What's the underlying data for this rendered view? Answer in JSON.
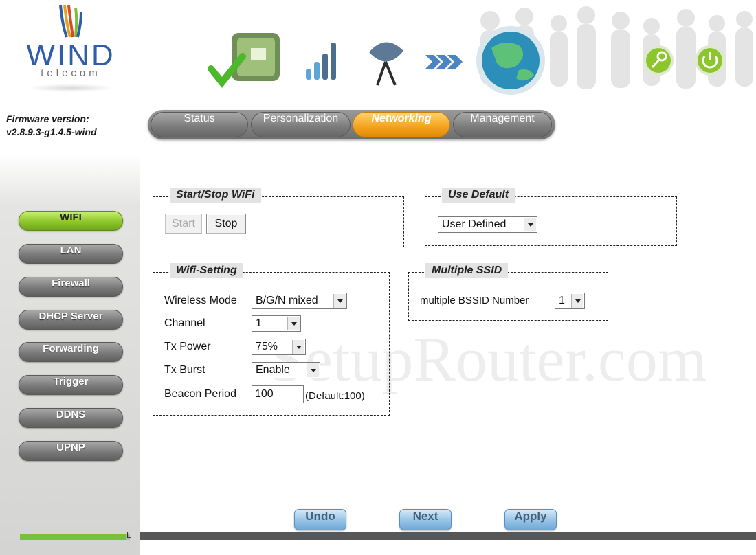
{
  "brand": {
    "name": "WIND",
    "subtitle": "telecom"
  },
  "firmware": {
    "label": "Firmware version:",
    "version": "v2.8.9.3-g1.4.5-wind"
  },
  "nav": {
    "tabs": [
      {
        "label": "Status",
        "active": false
      },
      {
        "label": "Personalization",
        "active": false
      },
      {
        "label": "Networking",
        "active": true
      },
      {
        "label": "Management",
        "active": false
      }
    ]
  },
  "sidebar": {
    "items": [
      {
        "label": "WIFI",
        "active": true
      },
      {
        "label": "LAN",
        "active": false
      },
      {
        "label": "Firewall",
        "active": false
      },
      {
        "label": "DHCP Server",
        "active": false
      },
      {
        "label": "Forwarding",
        "active": false
      },
      {
        "label": "Trigger",
        "active": false
      },
      {
        "label": "DDNS",
        "active": false
      },
      {
        "label": "UPNP",
        "active": false
      }
    ]
  },
  "start_stop": {
    "legend": "Start/Stop WiFi",
    "start_label": "Start",
    "start_enabled": false,
    "stop_label": "Stop"
  },
  "use_default": {
    "legend": "Use Default",
    "value": "User Defined"
  },
  "wifi_setting": {
    "legend": "Wifi-Setting",
    "wireless_mode": {
      "label": "Wireless Mode",
      "value": "B/G/N mixed"
    },
    "channel": {
      "label": "Channel",
      "value": "1"
    },
    "tx_power": {
      "label": "Tx Power",
      "value": "75%"
    },
    "tx_burst": {
      "label": "Tx Burst",
      "value": "Enable"
    },
    "beacon_period": {
      "label": "Beacon Period",
      "value": "100",
      "hint": "(Default:100)"
    }
  },
  "multiple_ssid": {
    "legend": "Multiple SSID",
    "label": "multiple BSSID Number",
    "value": "1"
  },
  "watermark": "SetupRouter.com",
  "actions": {
    "undo": "Undo",
    "next": "Next",
    "apply": "Apply"
  },
  "header_icons": [
    "setup-check-icon",
    "signal-bars-icon",
    "satellite-dish-icon",
    "arrows-icon",
    "globe-icon",
    "key-icon",
    "power-icon"
  ],
  "progress": {
    "fraction": 0.97,
    "end_label": "L"
  },
  "colors": {
    "active_tab": "#f3a21d",
    "active_side": "#8dc62c",
    "logo_blue": "#2f5da8",
    "action_button": "#99c6e7"
  }
}
